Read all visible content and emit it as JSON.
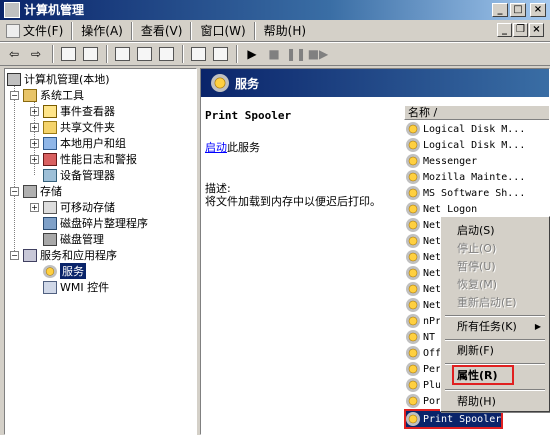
{
  "window": {
    "title": "计算机管理"
  },
  "menu": {
    "items": [
      "文件(F)",
      "操作(A)",
      "查看(V)",
      "窗口(W)",
      "帮助(H)"
    ]
  },
  "tree": {
    "root": "计算机管理(本地)",
    "system_tools": "系统工具",
    "event_viewer": "事件查看器",
    "shared_folders": "共享文件夹",
    "local_users": "本地用户和组",
    "perf_logs": "性能日志和警报",
    "device_manager": "设备管理器",
    "storage": "存储",
    "removable": "可移动存储",
    "defrag": "磁盘碎片整理程序",
    "disk_mgmt": "磁盘管理",
    "services_apps": "服务和应用程序",
    "services": "服务",
    "wmi": "WMI 控件"
  },
  "right": {
    "header": "服务",
    "service_name": "Print Spooler",
    "start_link": "启动",
    "start_suffix": "此服务",
    "desc_label": "描述:",
    "desc_text": "将文件加载到内存中以便迟后打印。"
  },
  "list": {
    "column_name": "名称  /",
    "rows": [
      "Logical Disk M...",
      "Logical Disk M...",
      "Messenger",
      "Mozilla Mainte...",
      "MS Software Sh...",
      "Net Logon",
      "Net",
      "Net",
      "Net",
      "Net",
      "Net",
      "Net",
      "nPr",
      "NT",
      "Off",
      "Per",
      "Plu",
      "Por",
      "Print Spooler"
    ]
  },
  "context_menu": {
    "start": "启动(S)",
    "stop": "停止(O)",
    "pause": "暂停(U)",
    "resume": "恢复(M)",
    "restart": "重新启动(E)",
    "all_tasks": "所有任务(K)",
    "refresh": "刷新(F)",
    "properties": "属性(R)",
    "help": "帮助(H)"
  }
}
